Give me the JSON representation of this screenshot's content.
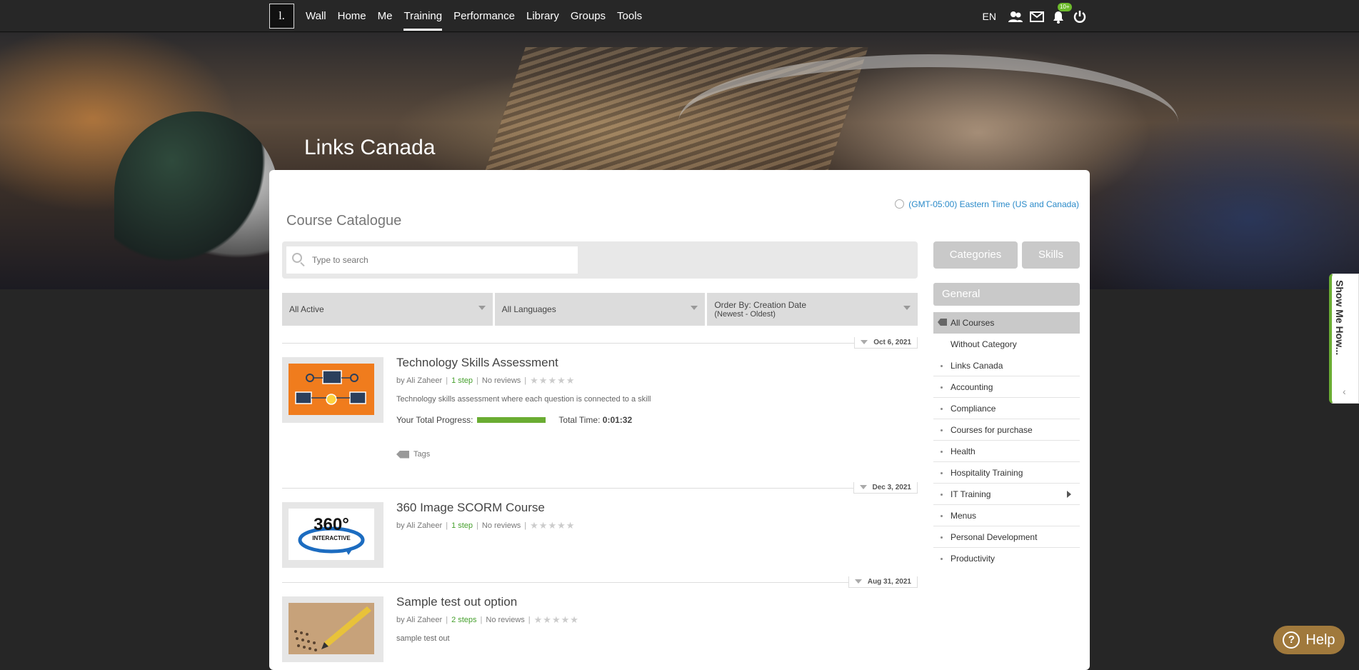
{
  "topbar": {
    "logo_text": "l.",
    "nav": [
      "Wall",
      "Home",
      "Me",
      "Training",
      "Performance",
      "Library",
      "Groups",
      "Tools"
    ],
    "active_nav": "Training",
    "language": "EN",
    "notification_badge": "10+"
  },
  "hero": {
    "title": "Links Canada"
  },
  "catalogue": {
    "timezone": "(GMT-05:00) Eastern Time (US and Canada)",
    "title": "Course Catalogue",
    "search_placeholder": "Type to search",
    "filters": {
      "status": "All Active",
      "language": "All Languages",
      "order_line1": "Order By: Creation Date",
      "order_line2": "(Newest - Oldest)"
    },
    "courses": [
      {
        "date": "Oct 6, 2021",
        "title": "Technology Skills Assessment",
        "author": "by Ali Zaheer",
        "steps": "1 step",
        "reviews": "No reviews",
        "description": "Technology skills assessment where each question is connected to a skill",
        "progress_label": "Your Total Progress:",
        "progress_fraction": 1.0,
        "time_label": "Total Time:",
        "time_value": "0:01:32",
        "tags_label": "Tags"
      },
      {
        "date": "Dec 3, 2021",
        "title": "360 Image SCORM Course",
        "author": "by Ali Zaheer",
        "steps": "1 step",
        "reviews": "No reviews",
        "thumb_text_big": "360°",
        "thumb_text_small": "INTERACTIVE"
      },
      {
        "date": "Aug 31, 2021",
        "title": "Sample test out option",
        "author": "by Ali Zaheer",
        "steps": "2 steps",
        "reviews": "No reviews",
        "description": "sample test out"
      }
    ]
  },
  "sidebar": {
    "categories_btn": "Categories",
    "skills_btn": "Skills",
    "general": "General",
    "items": [
      "All Courses",
      "Without Category",
      "Links Canada",
      "Accounting",
      "Compliance",
      "Courses for purchase",
      "Health",
      "Hospitality Training",
      "IT Training",
      "Menus",
      "Personal Development",
      "Productivity"
    ]
  },
  "showme": "Show Me How...",
  "help": "Help",
  "colors": {
    "accent_green": "#6aac32",
    "link_blue": "#2a8ac9",
    "help_brown": "#a0793c"
  }
}
